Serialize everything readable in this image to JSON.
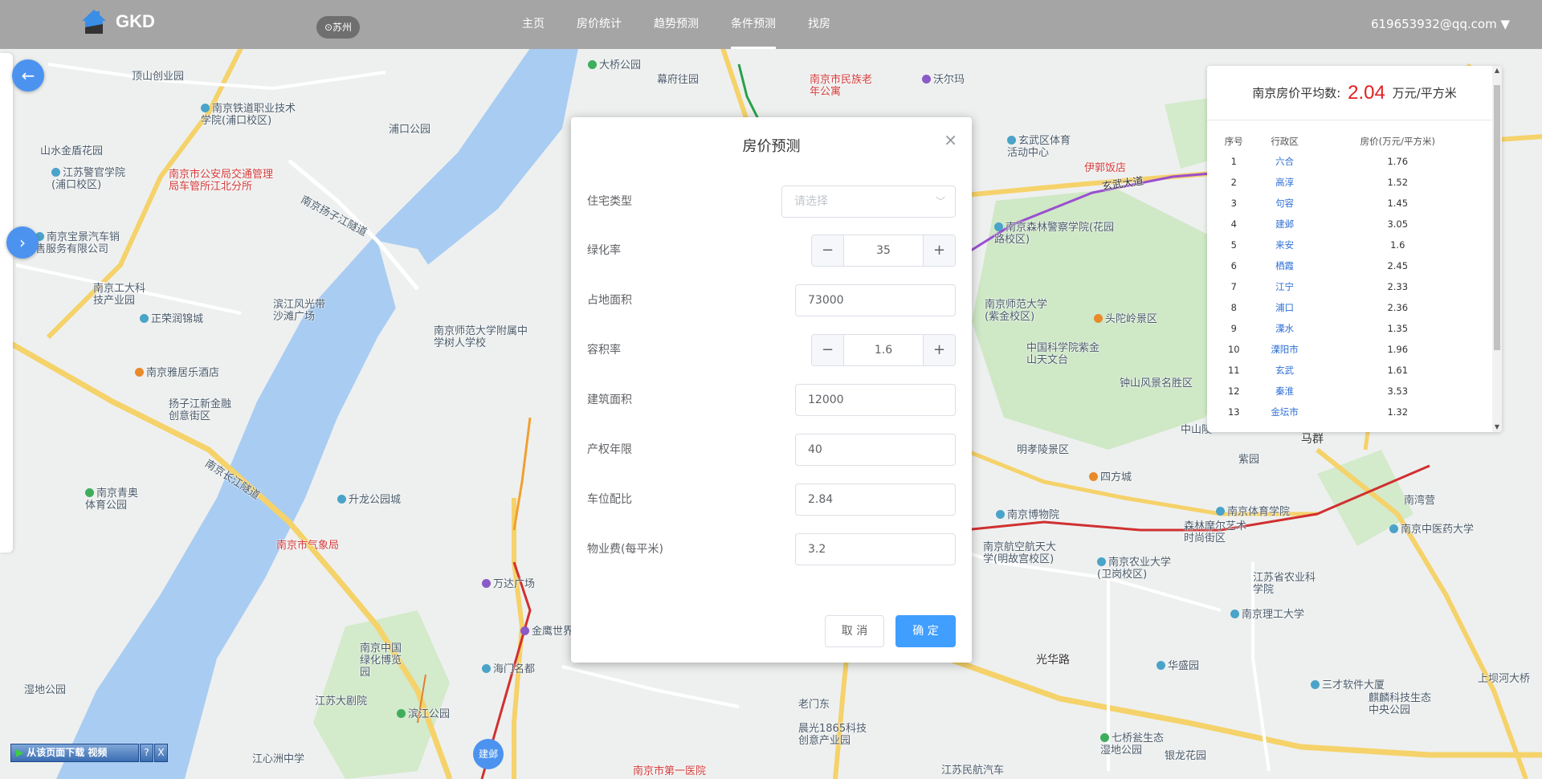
{
  "navbar": {
    "brand": "GKD",
    "city": "⊙苏州",
    "links": [
      "主页",
      "房价统计",
      "趋势预测",
      "条件预测",
      "找房"
    ],
    "active_link": "条件预测",
    "user": "619653932@qq.com ▼"
  },
  "left_controls": {
    "back_icon": "←",
    "next_icon": "›"
  },
  "stats": {
    "title_prefix": "南京房价平均数:",
    "average": "2.04",
    "unit": "万元/平方米",
    "columns": [
      "序号",
      "行政区",
      "房价(万元/平方米)"
    ],
    "rows": [
      {
        "no": "1",
        "district": "六合",
        "price": "1.76"
      },
      {
        "no": "2",
        "district": "高淳",
        "price": "1.52"
      },
      {
        "no": "3",
        "district": "句容",
        "price": "1.45"
      },
      {
        "no": "4",
        "district": "建邺",
        "price": "3.05"
      },
      {
        "no": "5",
        "district": "来安",
        "price": "1.6"
      },
      {
        "no": "6",
        "district": "栖霞",
        "price": "2.45"
      },
      {
        "no": "7",
        "district": "江宁",
        "price": "2.33"
      },
      {
        "no": "8",
        "district": "浦口",
        "price": "2.36"
      },
      {
        "no": "9",
        "district": "溧水",
        "price": "1.35"
      },
      {
        "no": "10",
        "district": "溧阳市",
        "price": "1.96"
      },
      {
        "no": "11",
        "district": "玄武",
        "price": "1.61"
      },
      {
        "no": "12",
        "district": "秦淮",
        "price": "3.53"
      },
      {
        "no": "13",
        "district": "金坛市",
        "price": "1.32"
      }
    ]
  },
  "modal": {
    "title": "房价预测",
    "close_icon": "×",
    "fields": {
      "house_type": {
        "label": "住宅类型",
        "placeholder": "请选择"
      },
      "green_rate": {
        "label": "绿化率",
        "value": "35"
      },
      "land_area": {
        "label": "占地面积",
        "value": "73000"
      },
      "plot_ratio": {
        "label": "容积率",
        "value": "1.6"
      },
      "build_area": {
        "label": "建筑面积",
        "value": "12000"
      },
      "property_years": {
        "label": "产权年限",
        "value": "40"
      },
      "parking_ratio": {
        "label": "车位配比",
        "value": "2.84"
      },
      "property_fee": {
        "label": "物业费(每平米)",
        "value": "3.2"
      }
    },
    "cancel": "取 消",
    "confirm": "确 定"
  },
  "download_bar": {
    "label": "从该页面下载 视频",
    "help": "?",
    "close": "X"
  },
  "map_marker": "建邺",
  "map_labels": {
    "l1": "顶山创业园",
    "l2": "南京铁道职业技术学院(浦口校区)",
    "l3": "浦口公园",
    "l4": "山水金盾花园",
    "l5": "江苏警官学院(浦口校区)",
    "l6": "南京市公安局交通管理局车管所江北分所",
    "l7": "南京扬子江隧道",
    "l8": "南京宝景汽车销售服务有限公司",
    "l9": "南京工大科技产业园",
    "l10": "正荣润锦城",
    "l11": "滨江风光带沙滩广场",
    "l12": "南京师范大学附属中学树人学校",
    "l13": "南京雅居乐酒店",
    "l14": "扬子江新金融创意街区",
    "l15": "南京长江隧道",
    "l16": "南京青奥体育公园",
    "l17": "南京市气象局",
    "l18": "升龙公园城",
    "l19": "滨江公园",
    "l20": "江苏大剧院",
    "l21": "大桥公园",
    "l22": "幕府往园",
    "l23": "南京市民族老年公寓",
    "l24": "沃尔玛",
    "l25": "玄武区体育活动中心",
    "l26": "伊郭饭店",
    "l27": "玄武大道",
    "l28": "南京森林警察学院(花园路校区)",
    "l29": "南京师范大学(紫金校区)",
    "l30": "头陀岭景区",
    "l31": "中国科学院紫金山天文台",
    "l32": "钟山风景名胜区",
    "l33": "明孝陵景区",
    "l34": "四方城",
    "l35": "南京博物院",
    "l36": "南京航空航天大学(明故宫校区)",
    "l37": "南京农业大学(卫岗校区)",
    "l38": "森林摩尔艺术时尚街区",
    "l39": "南京体育学院",
    "l40": "南京理工大学",
    "l41": "光华路",
    "l42": "南京市第一医院",
    "l43": "老门东",
    "l44": "晨光1865科技创意产业园",
    "l45": "三才软件大厦",
    "l46": "麒麟科技生态中央公园",
    "l47": "江苏民航汽车",
    "l48": "上坝河大桥",
    "l49": "中山陵",
    "l50": "马群",
    "l51": "紫园",
    "l52": "南湾营",
    "l53": "南京中医药大学",
    "l54": "湿地公园",
    "l55": "江心洲中学",
    "l56": "南京中国绿化博览园",
    "l57": "金鹰世界",
    "l58": "万达广场",
    "l59": "海门名都",
    "l60": "七桥瓮生态湿地公园",
    "l61": "银龙花园",
    "l62": "江苏省农业科学院",
    "l63": "华盛园"
  }
}
